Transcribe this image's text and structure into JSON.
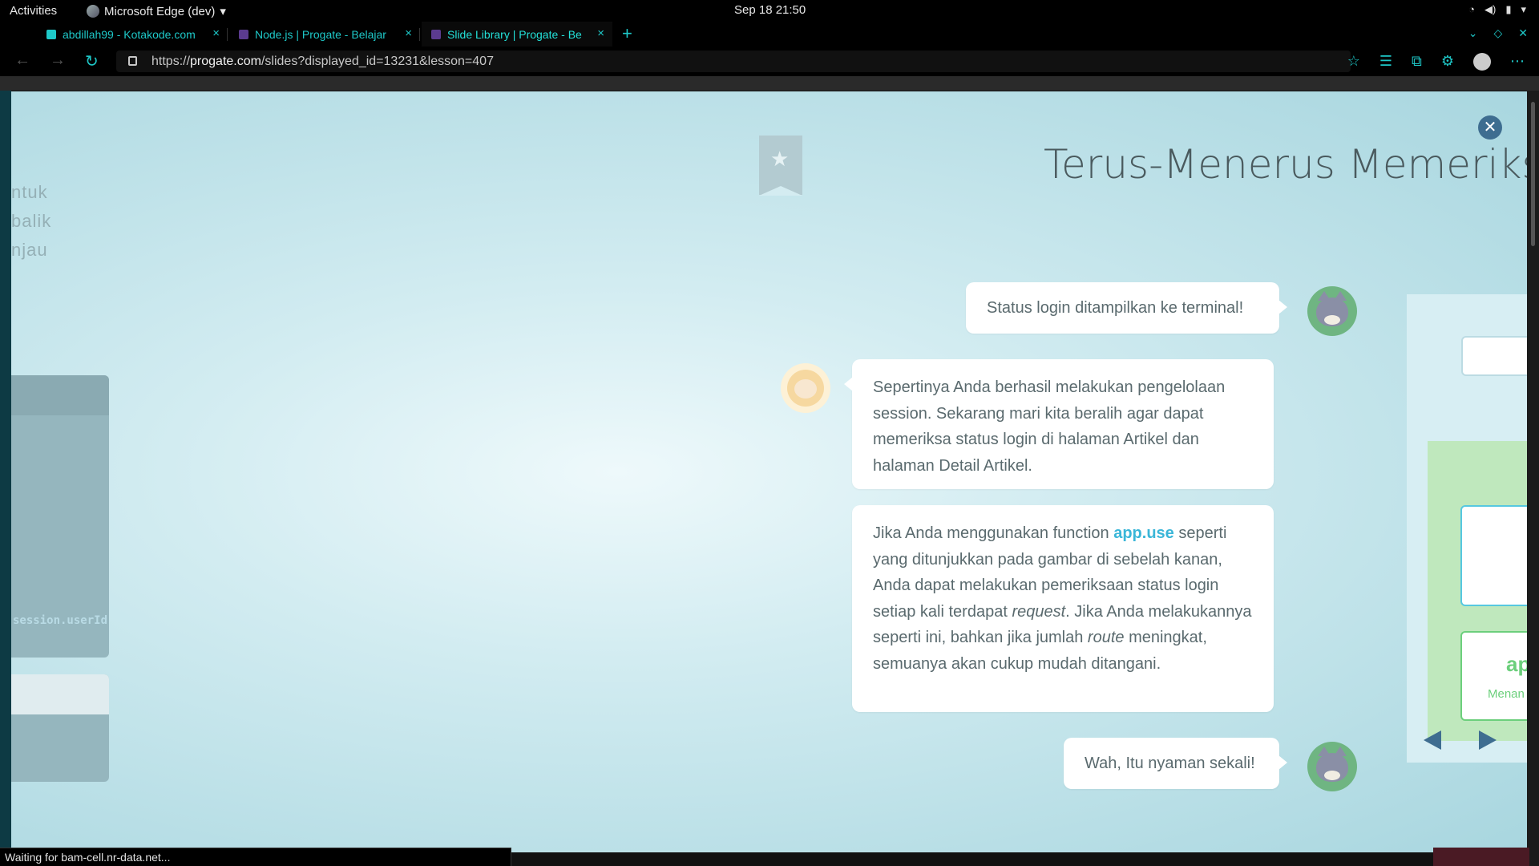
{
  "system_bar": {
    "activities": "Activities",
    "app_name": "Microsoft Edge (dev)",
    "clock": "Sep 18  21:50"
  },
  "tabs": [
    {
      "title": "abdillah99 - Kotakode.com",
      "favicon_color": "#1ec8c8"
    },
    {
      "title": "Node.js | Progate - Belajar",
      "favicon_color": "#5b3b8f"
    },
    {
      "title": "Slide Library | Progate - Belajar",
      "favicon_color": "#5b3b8f"
    }
  ],
  "address_bar": {
    "prefix": "https://",
    "domain": "progate.com",
    "path": "/slides?displayed_id=13231&lesson=407"
  },
  "slide": {
    "title": "Terus-Menerus Memeriksa S",
    "left_peek_lines": [
      "ntuk",
      "balik",
      "njau"
    ],
    "left_code": "session.userId",
    "messages": [
      {
        "speaker": "cat",
        "side": "right",
        "text": "Status login ditampilkan ke terminal!"
      },
      {
        "speaker": "sheep",
        "side": "left",
        "text": "Sepertinya Anda berhasil melakukan pengelolaan session. Sekarang mari kita beralih agar dapat memeriksa status login di halaman Artikel dan halaman Detail Artikel."
      },
      {
        "speaker": "sheep",
        "side": "left",
        "part1": "Jika Anda menggunakan function ",
        "highlight": "app.use",
        "part2": " seperti yang ditunjukkan pada gambar di sebelah kanan, Anda dapat melakukan pemeriksaan status login setiap kali terdapat ",
        "italic1": "request",
        "part3": ". Jika Anda melakukannya seperti ini, bahkan jika jumlah ",
        "italic2": "route",
        "part4": " meningkat, semuanya akan cukup mudah ditangani."
      },
      {
        "speaker": "cat",
        "side": "right",
        "text": "Wah, Itu nyaman sekali!"
      }
    ],
    "right_panel": {
      "box_title": "ap",
      "box_sub": "Menan"
    }
  },
  "status_bar": {
    "text": "Waiting for bam-cell.nr-data.net..."
  },
  "colors": {
    "highlight": "#3ab6d8",
    "close_button": "#3e6d90",
    "accent_teal": "#1ec8c8"
  }
}
